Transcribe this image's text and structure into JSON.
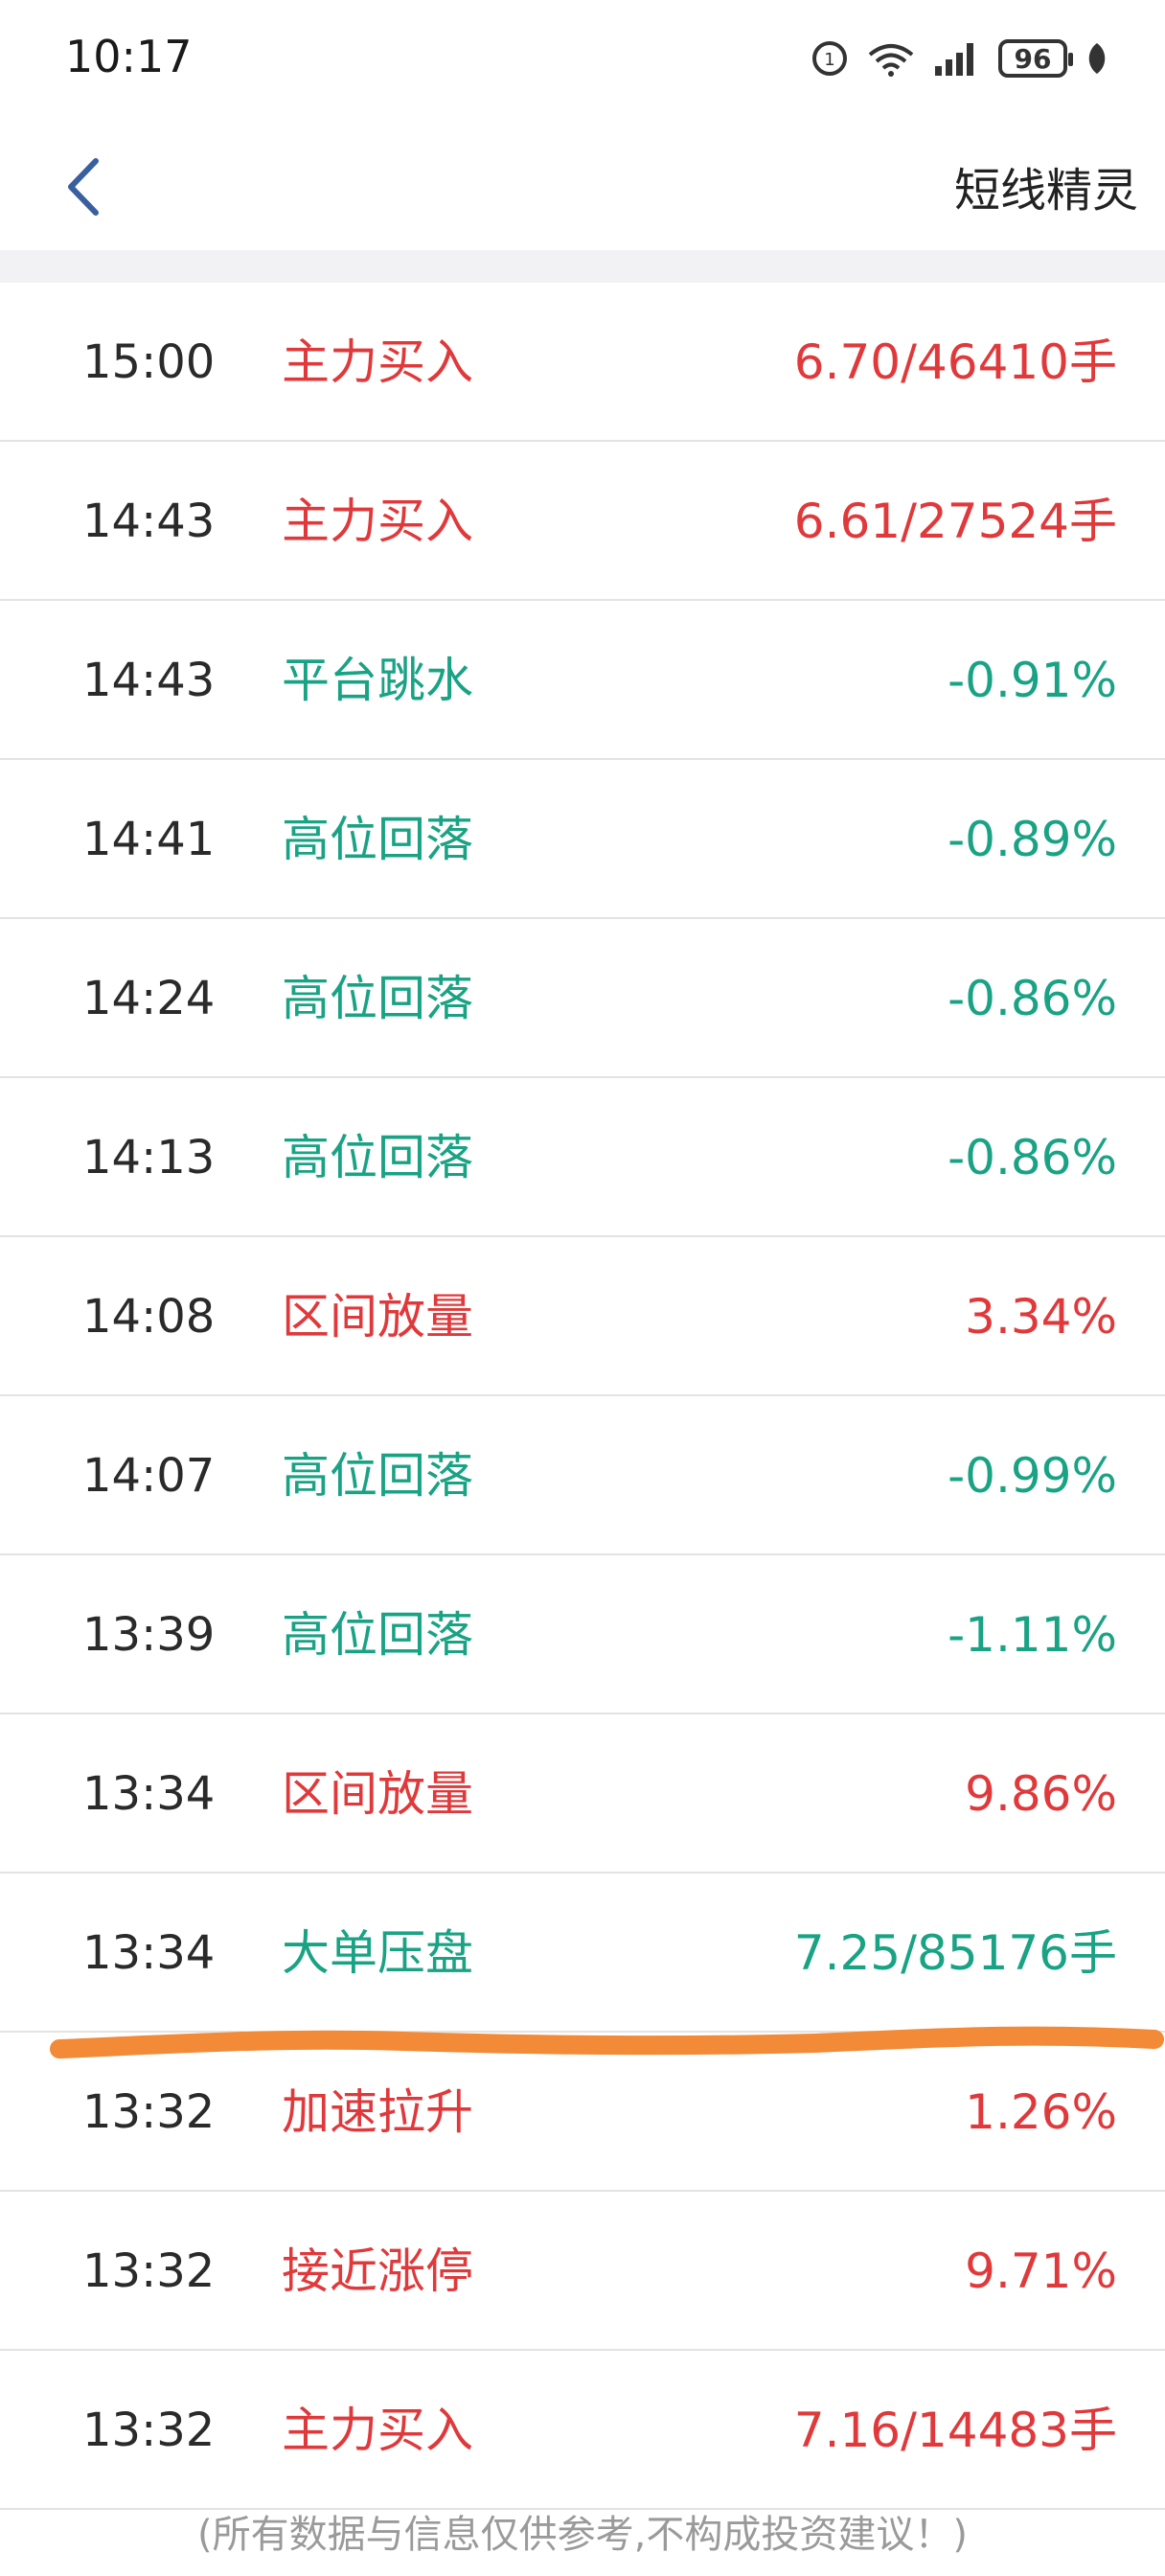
{
  "status_bar": {
    "time": "10:17",
    "battery": "96"
  },
  "header": {
    "title": "短线精灵"
  },
  "colors": {
    "up": "#e0393b",
    "down": "#19a384",
    "annotation": "#f28a38"
  },
  "rows": [
    {
      "time": "15:00",
      "signal": "主力买入",
      "value": "6.70/46410手",
      "color": "red"
    },
    {
      "time": "14:43",
      "signal": "主力买入",
      "value": "6.61/27524手",
      "color": "red"
    },
    {
      "time": "14:43",
      "signal": "平台跳水",
      "value": "-0.91%",
      "color": "green"
    },
    {
      "time": "14:41",
      "signal": "高位回落",
      "value": "-0.89%",
      "color": "green"
    },
    {
      "time": "14:24",
      "signal": "高位回落",
      "value": "-0.86%",
      "color": "green"
    },
    {
      "time": "14:13",
      "signal": "高位回落",
      "value": "-0.86%",
      "color": "green"
    },
    {
      "time": "14:08",
      "signal": "区间放量",
      "value": "3.34%",
      "color": "red"
    },
    {
      "time": "14:07",
      "signal": "高位回落",
      "value": "-0.99%",
      "color": "green"
    },
    {
      "time": "13:39",
      "signal": "高位回落",
      "value": "-1.11%",
      "color": "green"
    },
    {
      "time": "13:34",
      "signal": "区间放量",
      "value": "9.86%",
      "color": "red"
    },
    {
      "time": "13:34",
      "signal": "大单压盘",
      "value": "7.25/85176手",
      "color": "green"
    },
    {
      "time": "13:32",
      "signal": "加速拉升",
      "value": "1.26%",
      "color": "red"
    },
    {
      "time": "13:32",
      "signal": "接近涨停",
      "value": "9.71%",
      "color": "red"
    },
    {
      "time": "13:32",
      "signal": "主力买入",
      "value": "7.16/14483手",
      "color": "red"
    }
  ],
  "footer": {
    "disclaimer": "(所有数据与信息仅供参考,不构成投资建议！)"
  }
}
